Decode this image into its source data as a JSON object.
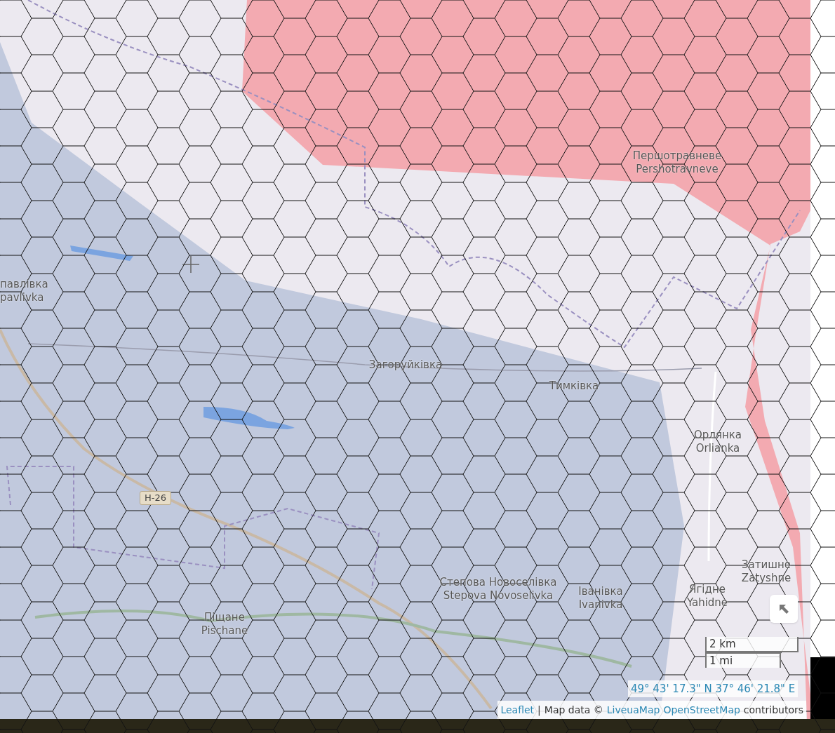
{
  "map": {
    "labels": [
      {
        "lines": [
          "павлівка",
          "pavlivka"
        ]
      },
      {
        "lines": [
          "Першотравневе",
          "Pershotravneve"
        ]
      },
      {
        "lines": [
          "Загоруйківка"
        ]
      },
      {
        "lines": [
          "Тимківка"
        ]
      },
      {
        "lines": [
          "Орлянка",
          "Orlianka"
        ]
      },
      {
        "lines": [
          "Затишне",
          "Zatyshne"
        ]
      },
      {
        "lines": [
          "Степова Новоселівка",
          "Stepova Novoselivka"
        ]
      },
      {
        "lines": [
          "Іванівка",
          "Ivanivka"
        ]
      },
      {
        "lines": [
          "Ягідне",
          "Yahidne"
        ]
      },
      {
        "lines": [
          "Піщане",
          "Pischane"
        ]
      }
    ],
    "road_shield": "Н-26",
    "scale": {
      "metric": "2 km",
      "imperial": "1 mi"
    },
    "coordinates": "49° 43' 17.3\" N 37° 46' 21.8\" E",
    "attribution": [
      {
        "text": "Leaflet",
        "kind": "link"
      },
      {
        "text": "|",
        "kind": "text"
      },
      {
        "text": "Map data ©",
        "kind": "text"
      },
      {
        "text": "LiveuaMap",
        "kind": "link"
      },
      {
        "text": "OpenStreetMap",
        "kind": "link"
      },
      {
        "text": "contributors",
        "kind": "text"
      }
    ]
  }
}
